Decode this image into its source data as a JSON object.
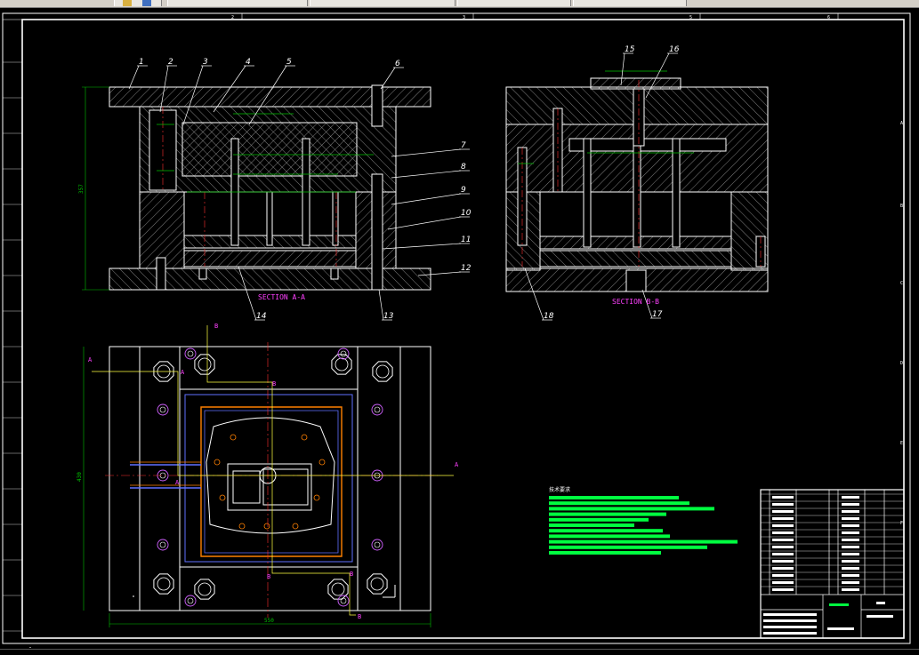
{
  "colors": {
    "background": "#000000",
    "outline": "#ffffff",
    "hatch": "#d0d0d0",
    "dimension": "#00c000",
    "leader": "#ffffff",
    "section_text": "#ff40ff",
    "center_line": "#ff3030",
    "cooling": "#ff8000",
    "cooling_blue": "#6070ff",
    "note_green": "#00ff40",
    "table_line": "#ffffff"
  },
  "border": {
    "top_zones": [
      "2",
      "3",
      "5",
      "6"
    ],
    "left_zones": [
      "A",
      "B",
      "C",
      "D",
      "E",
      "F"
    ]
  },
  "part_numbers": [
    "1",
    "2",
    "3",
    "4",
    "5",
    "6",
    "7",
    "8",
    "9",
    "10",
    "11",
    "12",
    "13",
    "14",
    "15",
    "16",
    "17",
    "18"
  ],
  "section_labels": {
    "aa": "SECTION A-A",
    "bb": "SECTION B-B"
  },
  "cut_markers": {
    "a": "A",
    "b": "B"
  },
  "dimensions": {
    "overall_height": "357",
    "plan_height": "430",
    "plan_width": "550"
  },
  "notes": {
    "heading": "技术要求"
  },
  "icons": [
    "cursor-icon"
  ]
}
